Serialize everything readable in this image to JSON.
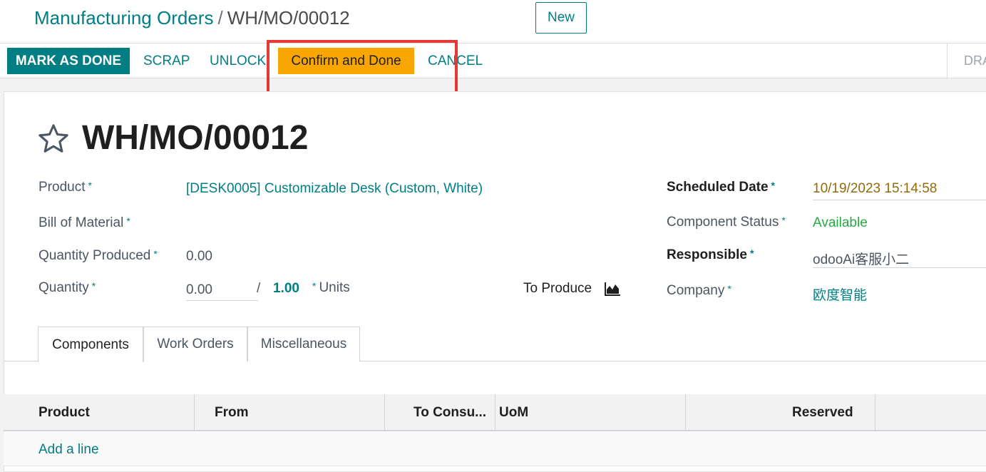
{
  "breadcrumb": {
    "parent": "Manufacturing Orders",
    "separator": "/",
    "current": "WH/MO/00012"
  },
  "header": {
    "new_label": "New"
  },
  "actions": {
    "mark_done": "MARK AS DONE",
    "scrap": "SCRAP",
    "unlock": "UNLOCK",
    "confirm_done": "Confirm and Done",
    "cancel": "CANCEL"
  },
  "status": {
    "current": "DRA"
  },
  "record": {
    "title": "WH/MO/00012"
  },
  "fields": {
    "product": {
      "label": "Product",
      "value": "[DESK0005] Customizable Desk (Custom, White)"
    },
    "bom": {
      "label": "Bill of Material",
      "value": ""
    },
    "qty_produced": {
      "label": "Quantity Produced",
      "value": "0.00"
    },
    "quantity": {
      "label": "Quantity",
      "value": "0.00",
      "separator": "/",
      "max": "1.00",
      "unit": "Units"
    },
    "to_produce": {
      "label": "To Produce"
    },
    "scheduled_date": {
      "label": "Scheduled Date",
      "value": "10/19/2023 15:14:58"
    },
    "component_status": {
      "label": "Component Status",
      "value": "Available"
    },
    "responsible": {
      "label": "Responsible",
      "value": "odooAi客服小二"
    },
    "company": {
      "label": "Company",
      "value": "欧度智能"
    },
    "required_mark": "*"
  },
  "tabs": [
    {
      "label": "Components"
    },
    {
      "label": "Work Orders"
    },
    {
      "label": "Miscellaneous"
    }
  ],
  "table": {
    "columns": [
      "Product",
      "From",
      "To Consu...",
      "UoM",
      "Reserved"
    ],
    "add_line": "Add a line"
  },
  "colors": {
    "brand": "#017e84",
    "accent_button": "#f9a602",
    "highlight": "#e53935",
    "status_available": "#28a745",
    "date": "#946a09"
  },
  "icons": {
    "favorite": "star-icon",
    "forecast": "area-chart-icon"
  }
}
